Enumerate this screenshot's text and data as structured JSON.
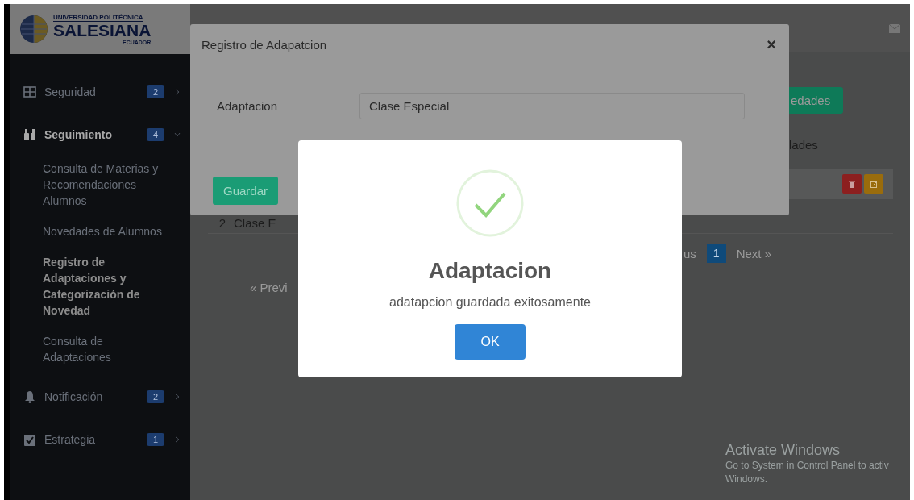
{
  "logo": {
    "top": "UNIVERSIDAD POLITÉCNICA",
    "name": "SALESIANA",
    "country": "ECUADOR"
  },
  "sidebar": {
    "items": [
      {
        "label": "Seguridad",
        "badge": "2",
        "expanded": false,
        "selected": false
      },
      {
        "label": "Seguimiento",
        "badge": "4",
        "expanded": true,
        "selected": true,
        "children": [
          {
            "label": "Consulta de Materias y Recomendaciones Alumnos",
            "selected": false
          },
          {
            "label": "Novedades de Alumnos",
            "selected": false
          },
          {
            "label": "Registro de Adaptaciones y Categorización de Novedad",
            "selected": true
          },
          {
            "label": "Consulta de Adaptaciones",
            "selected": false
          }
        ]
      },
      {
        "label": "Notificación",
        "badge": "2",
        "expanded": false,
        "selected": false
      },
      {
        "label": "Estrategia",
        "badge": "1",
        "expanded": false,
        "selected": false
      }
    ]
  },
  "background": {
    "button": "edades",
    "heading": "lades",
    "row": {
      "index": "2",
      "text": "Clase E"
    },
    "pagination": {
      "previous_right": "us",
      "page": "1",
      "next": "Next »"
    },
    "previous_left": "« Previ"
  },
  "modal": {
    "title": "Registro de Adapatcion",
    "close": "×",
    "field_label": "Adaptacion",
    "field_value": "Clase Especial",
    "save": "Guardar"
  },
  "alert": {
    "title": "Adaptacion",
    "message": "adatapcion guardada exitosamente",
    "ok": "OK"
  },
  "os_notice": {
    "title": "Activate Windows",
    "text": "Go to System in Control Panel to activ",
    "text2": "Windows."
  }
}
